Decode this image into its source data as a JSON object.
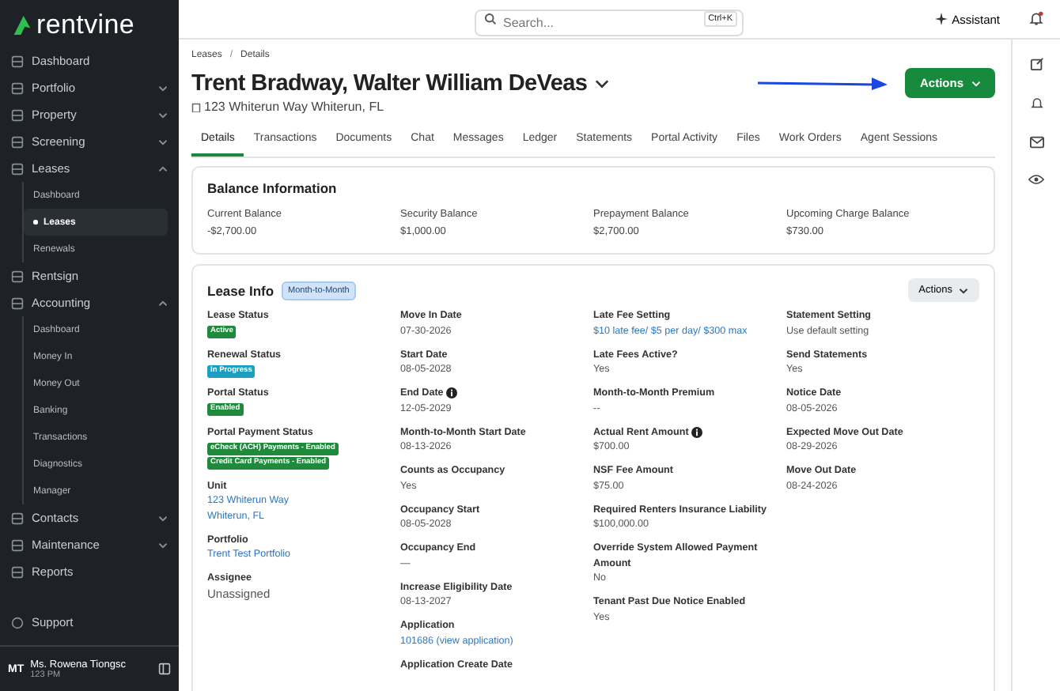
{
  "sidebar": {
    "logo": "rentvine",
    "items": [
      {
        "label": "Dashboard",
        "kind": "link"
      },
      {
        "label": "Portfolio",
        "kind": "group",
        "expanded": false
      },
      {
        "label": "Property",
        "kind": "group",
        "expanded": false
      },
      {
        "label": "Screening",
        "kind": "group",
        "expanded": false
      },
      {
        "label": "Leases",
        "kind": "group",
        "expanded": true,
        "children": [
          {
            "label": "Dashboard",
            "selected": false
          },
          {
            "label": "Leases",
            "selected": true
          },
          {
            "label": "Renewals",
            "selected": false
          }
        ]
      },
      {
        "label": "Rentsign",
        "kind": "link"
      },
      {
        "label": "Accounting",
        "kind": "group",
        "expanded": true,
        "children": [
          {
            "label": "Dashboard",
            "selected": false
          },
          {
            "label": "Money In",
            "selected": false
          },
          {
            "label": "Money Out",
            "selected": false
          },
          {
            "label": "Banking",
            "selected": false
          },
          {
            "label": "Transactions",
            "selected": false
          },
          {
            "label": "Diagnostics",
            "selected": false
          },
          {
            "label": "Manager",
            "selected": false
          }
        ]
      },
      {
        "label": "Contacts",
        "kind": "group",
        "expanded": false
      },
      {
        "label": "Maintenance",
        "kind": "group",
        "expanded": false
      },
      {
        "label": "Reports",
        "kind": "link"
      }
    ],
    "support": "Support",
    "user": {
      "initials": "MT",
      "name": "Ms. Rowena Tiongsc",
      "time": "123 PM"
    }
  },
  "topbar": {
    "search": {
      "placeholder": "Search...",
      "shortcut": "Ctrl+K"
    },
    "assistant": "Assistant",
    "notification_dot": true
  },
  "breadcrumb": {
    "separator": "/",
    "items": [
      "Leases",
      "Details"
    ]
  },
  "title": "Trent Bradway, Walter William DeVeas",
  "address": "123 Whiterun Way Whiterun, FL",
  "actions_button": "Actions",
  "tabs": [
    {
      "label": "Details",
      "selected": true
    },
    {
      "label": "Transactions",
      "selected": false
    },
    {
      "label": "Documents",
      "selected": false
    },
    {
      "label": "Chat",
      "selected": false
    },
    {
      "label": "Messages",
      "selected": false
    },
    {
      "label": "Ledger",
      "selected": false
    },
    {
      "label": "Statements",
      "selected": false
    },
    {
      "label": "Portal Activity",
      "selected": false
    },
    {
      "label": "Files",
      "selected": false
    },
    {
      "label": "Work Orders",
      "selected": false
    },
    {
      "label": "Agent Sessions",
      "selected": false
    }
  ],
  "balance": {
    "title": "Balance Information",
    "items": [
      {
        "label": "Current Balance",
        "value": "-$2,700.00"
      },
      {
        "label": "Security Balance",
        "value": "$1,000.00"
      },
      {
        "label": "Prepayment Balance",
        "value": "$2,700.00"
      },
      {
        "label": "Upcoming Charge Balance",
        "value": "$730.00"
      }
    ]
  },
  "lease_info": {
    "title": "Lease Info",
    "tag": "Month-to-Month",
    "actions": "Actions",
    "columns": [
      [
        {
          "label": "Lease Status",
          "kind": "badges",
          "badges": [
            {
              "text": "Active",
              "color": "#1f8a3c"
            }
          ]
        },
        {
          "label": "Renewal Status",
          "kind": "badges",
          "badges": [
            {
              "text": "In Progress",
              "color": "#1a9fc0"
            }
          ]
        },
        {
          "label": "Portal Status",
          "kind": "badges",
          "badges": [
            {
              "text": "Enabled",
              "color": "#1f8a3c"
            }
          ]
        },
        {
          "label": "Portal Payment Status",
          "kind": "badges",
          "badges": [
            {
              "text": "eCheck (ACH) Payments - Enabled",
              "color": "#1f8a3c"
            },
            {
              "text": "Credit Card Payments - Enabled",
              "color": "#1f8a3c"
            }
          ]
        },
        {
          "label": "Unit",
          "kind": "link",
          "lines": [
            "123 Whiterun Way",
            "Whiterun, FL"
          ]
        },
        {
          "label": "Portfolio",
          "kind": "link",
          "lines": [
            "Trent Test Portfolio"
          ]
        },
        {
          "label": "Assignee",
          "kind": "large",
          "lines": [
            "Unassigned"
          ]
        }
      ],
      [
        {
          "label": "Move In Date",
          "kind": "text",
          "lines": [
            "07-30-2026"
          ]
        },
        {
          "label": "Start Date",
          "kind": "text",
          "lines": [
            "08-05-2028"
          ]
        },
        {
          "label": "End Date",
          "kind": "text",
          "info": true,
          "lines": [
            "12-05-2029"
          ]
        },
        {
          "label": "Month-to-Month Start Date",
          "kind": "text",
          "lines": [
            "08-13-2026"
          ]
        },
        {
          "label": "Counts as Occupancy",
          "kind": "text",
          "lines": [
            "Yes"
          ]
        },
        {
          "label": "Occupancy Start",
          "kind": "text",
          "lines": [
            "08-05-2028"
          ]
        },
        {
          "label": "Occupancy End",
          "kind": "text",
          "lines": [
            "—"
          ]
        },
        {
          "label": "Increase Eligibility Date",
          "kind": "text",
          "lines": [
            "08-13-2027"
          ]
        },
        {
          "label": "Application",
          "kind": "link",
          "lines": [
            "101686 (view application)"
          ]
        },
        {
          "label": "Application Create Date",
          "kind": "text"
        }
      ],
      [
        {
          "label": "Late Fee Setting",
          "kind": "link",
          "lines": [
            "$10 late fee/ $5 per day/ $300 max"
          ]
        },
        {
          "label": "Late Fees Active?",
          "kind": "text",
          "lines": [
            "Yes"
          ]
        },
        {
          "label": "Month-to-Month Premium",
          "kind": "text",
          "lines": [
            "--"
          ]
        },
        {
          "label": "Actual Rent Amount",
          "kind": "text",
          "info": true,
          "lines": [
            "$700.00"
          ]
        },
        {
          "label": "NSF Fee Amount",
          "kind": "text",
          "lines": [
            "$75.00"
          ]
        },
        {
          "label": "Required Renters Insurance Liability",
          "kind": "text",
          "lines": [
            "$100,000.00"
          ]
        },
        {
          "label": "Override System Allowed Payment Amount",
          "kind": "text",
          "lines": [
            "No"
          ]
        },
        {
          "label": "Tenant Past Due Notice Enabled",
          "kind": "text",
          "lines": [
            "Yes"
          ]
        }
      ],
      [
        {
          "label": "Statement Setting",
          "kind": "text",
          "lines": [
            "Use default setting"
          ]
        },
        {
          "label": "Send Statements",
          "kind": "text",
          "lines": [
            "Yes"
          ]
        },
        {
          "label": "Notice Date",
          "kind": "text",
          "lines": [
            "08-05-2026"
          ]
        },
        {
          "label": "Expected Move Out Date",
          "kind": "text",
          "lines": [
            "08-29-2026"
          ]
        },
        {
          "label": "Move Out Date",
          "kind": "text",
          "lines": [
            "08-24-2026"
          ]
        }
      ]
    ]
  }
}
